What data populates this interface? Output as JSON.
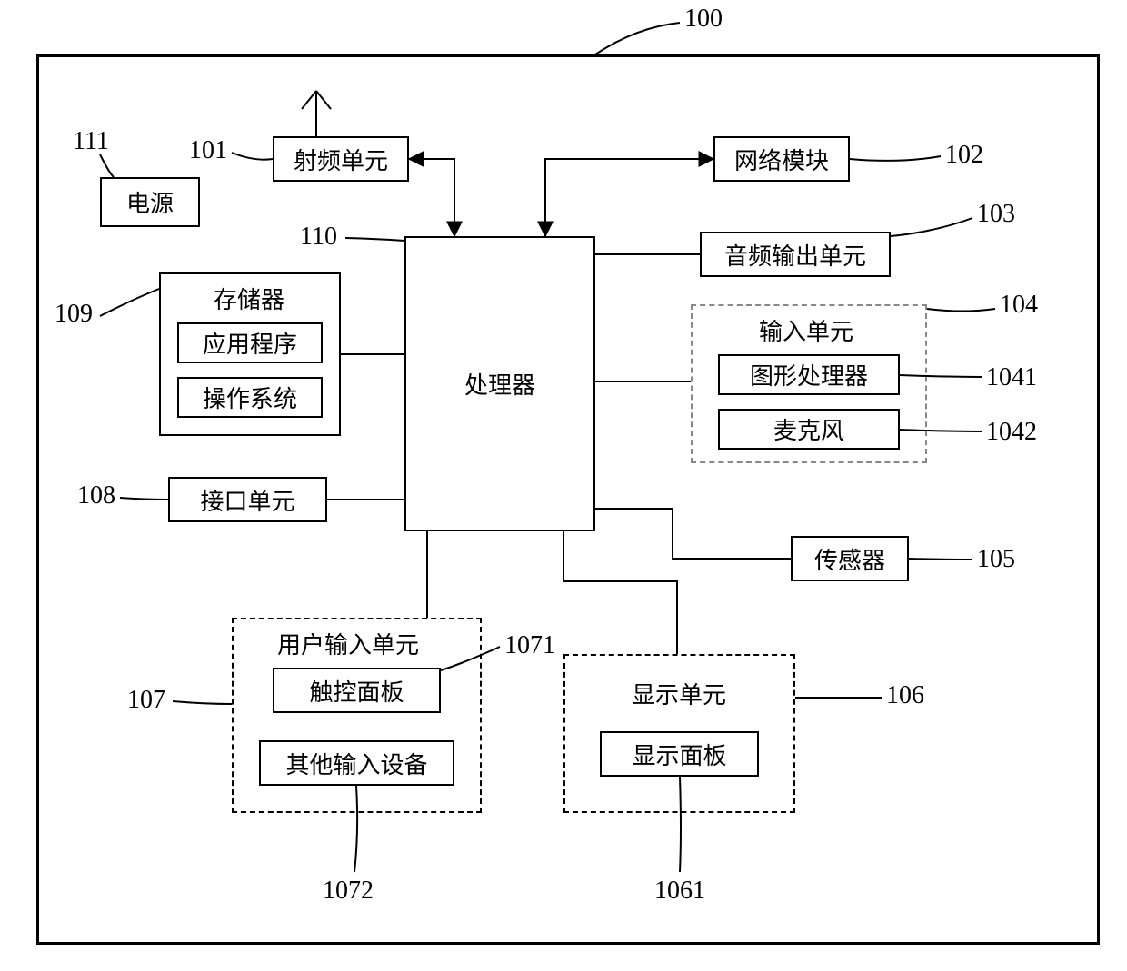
{
  "refs": {
    "r100": "100",
    "r101": "101",
    "r102": "102",
    "r103": "103",
    "r104": "104",
    "r105": "105",
    "r106": "106",
    "r1061": "1061",
    "r107": "107",
    "r1071": "1071",
    "r1072": "1072",
    "r108": "108",
    "r109": "109",
    "r110": "110",
    "r111": "111",
    "r1041": "1041",
    "r1042": "1042"
  },
  "blocks": {
    "rf_unit": "射频单元",
    "network_module": "网络模块",
    "audio_output": "音频输出单元",
    "input_unit": "输入单元",
    "gpu": "图形处理器",
    "microphone": "麦克风",
    "sensor": "传感器",
    "display_unit": "显示单元",
    "display_panel": "显示面板",
    "user_input_unit": "用户输入单元",
    "touch_panel": "触控面板",
    "other_input": "其他输入设备",
    "interface_unit": "接口单元",
    "memory": "存储器",
    "app": "应用程序",
    "os": "操作系统",
    "processor": "处理器",
    "power": "电源"
  }
}
